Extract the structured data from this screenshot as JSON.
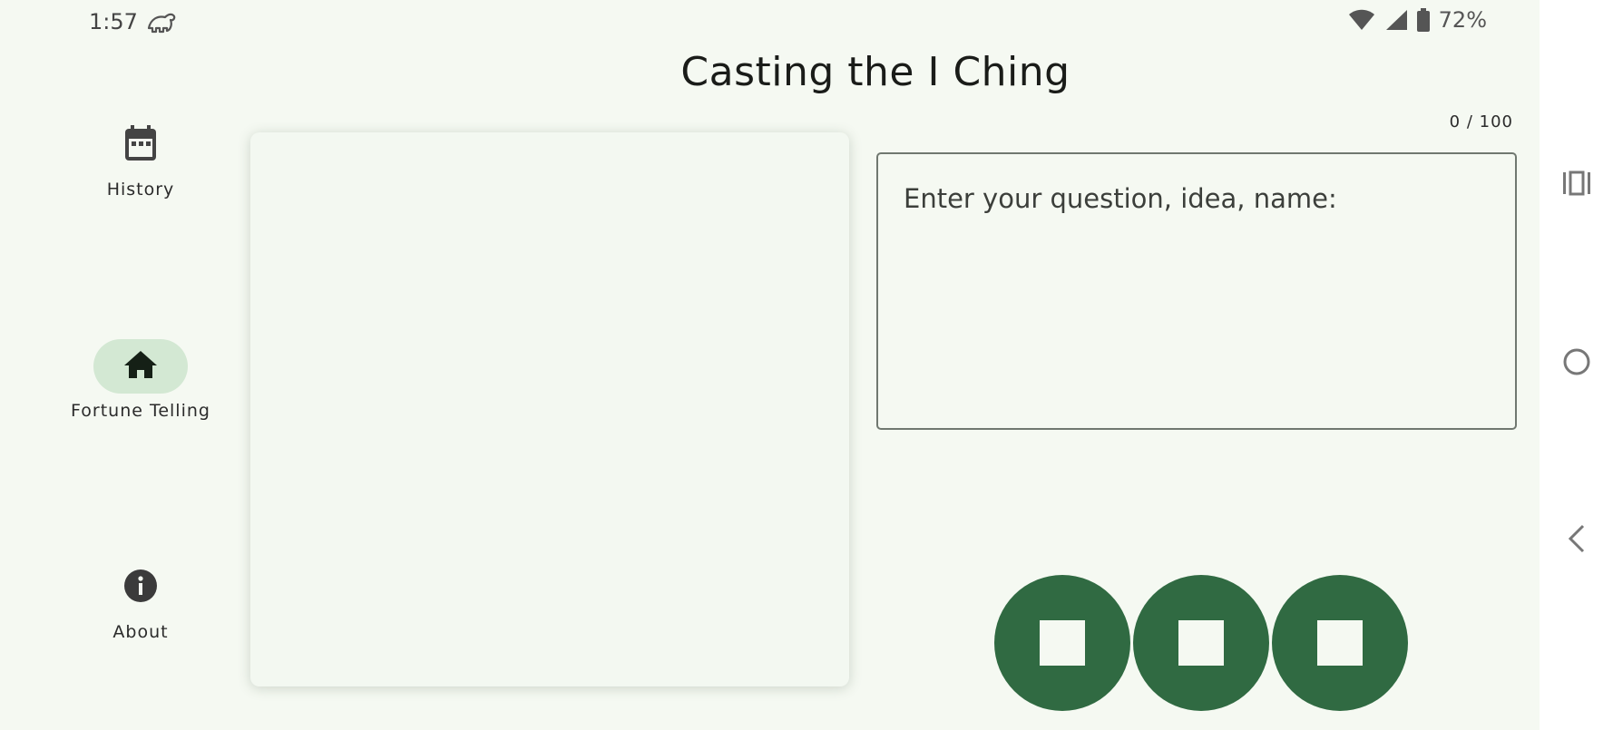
{
  "status_bar": {
    "time": "1:57",
    "app_icon": "dinosaur-icon",
    "wifi_icon": "wifi-icon",
    "signal_icon": "cell-signal-icon",
    "battery_icon": "battery-icon",
    "battery_percent": "72%"
  },
  "page": {
    "title": "Casting the I Ching"
  },
  "nav_rail": {
    "items": [
      {
        "label": "History",
        "icon": "calendar-icon",
        "active": false
      },
      {
        "label": "Fortune Telling",
        "icon": "home-icon",
        "active": true
      },
      {
        "label": "About",
        "icon": "info-icon",
        "active": false
      }
    ]
  },
  "question": {
    "counter": "0 / 100",
    "placeholder": "Enter your question, idea, name:",
    "value": ""
  },
  "coins": {
    "count": 3,
    "icon": "coin-icon"
  },
  "system_nav": {
    "recents_icon": "recents-icon",
    "home_icon": "home-circle-icon",
    "back_icon": "back-icon"
  },
  "colors": {
    "background": "#f5f9f2",
    "accent": "#306a42",
    "active_pill": "#d3e8d3"
  }
}
